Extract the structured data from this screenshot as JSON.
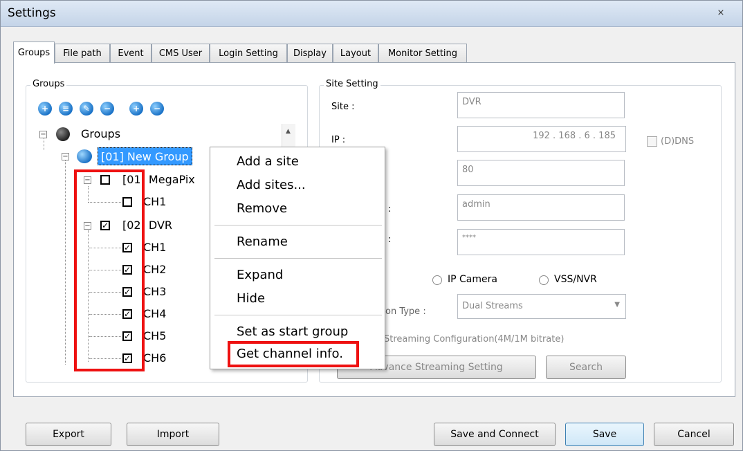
{
  "window": {
    "title": "Settings",
    "close_glyph": "⨯"
  },
  "tabs": [
    {
      "label": "Groups",
      "active": true
    },
    {
      "label": "File path"
    },
    {
      "label": "Event"
    },
    {
      "label": "CMS User"
    },
    {
      "label": "Login Setting"
    },
    {
      "label": "Display"
    },
    {
      "label": "Layout"
    },
    {
      "label": "Monitor Setting"
    }
  ],
  "groups_panel": {
    "title": "Groups",
    "toolbar_icons": [
      "add-group-icon",
      "add-site-icon",
      "edit-icon",
      "remove-icon",
      "zoom-in-icon",
      "zoom-out-icon"
    ],
    "tree": {
      "root": "Groups",
      "group": "[01] New Group",
      "site1": "[01] MegaPix",
      "site1_channels": [
        "CH1"
      ],
      "site2": "[02] DVR",
      "site2_channels": [
        "CH1",
        "CH2",
        "CH3",
        "CH4",
        "CH5",
        "CH6"
      ]
    }
  },
  "site_setting": {
    "title": "Site Setting",
    "site_label": "Site :",
    "site_value": "DVR",
    "ip_label": "IP :",
    "ip_value": "192 . 168 .  6  . 185",
    "ddns_label": "(D)DNS",
    "port_value": "80",
    "user_label": ":",
    "user_value": "admin",
    "password_label": ":",
    "password_value": "****",
    "radio_ipcamera": "IP Camera",
    "radio_vssnvr": "VSS/NVR",
    "connection_type_label": "on Type :",
    "connection_type_value": "Dual Streams",
    "streaming_config": "Streaming Configuration(4M/1M bitrate)",
    "advance_streaming_button": "Advance Streaming Setting",
    "search_button": "Search"
  },
  "context_menu": {
    "items": [
      "Add a site",
      "Add sites...",
      "Remove",
      "Rename",
      "Expand",
      "Hide",
      "Set as start group",
      "Get channel info."
    ]
  },
  "footer": {
    "export": "Export",
    "import": "Import",
    "save_connect": "Save and Connect",
    "save": "Save",
    "cancel": "Cancel"
  },
  "highlight_color": "#e11111"
}
